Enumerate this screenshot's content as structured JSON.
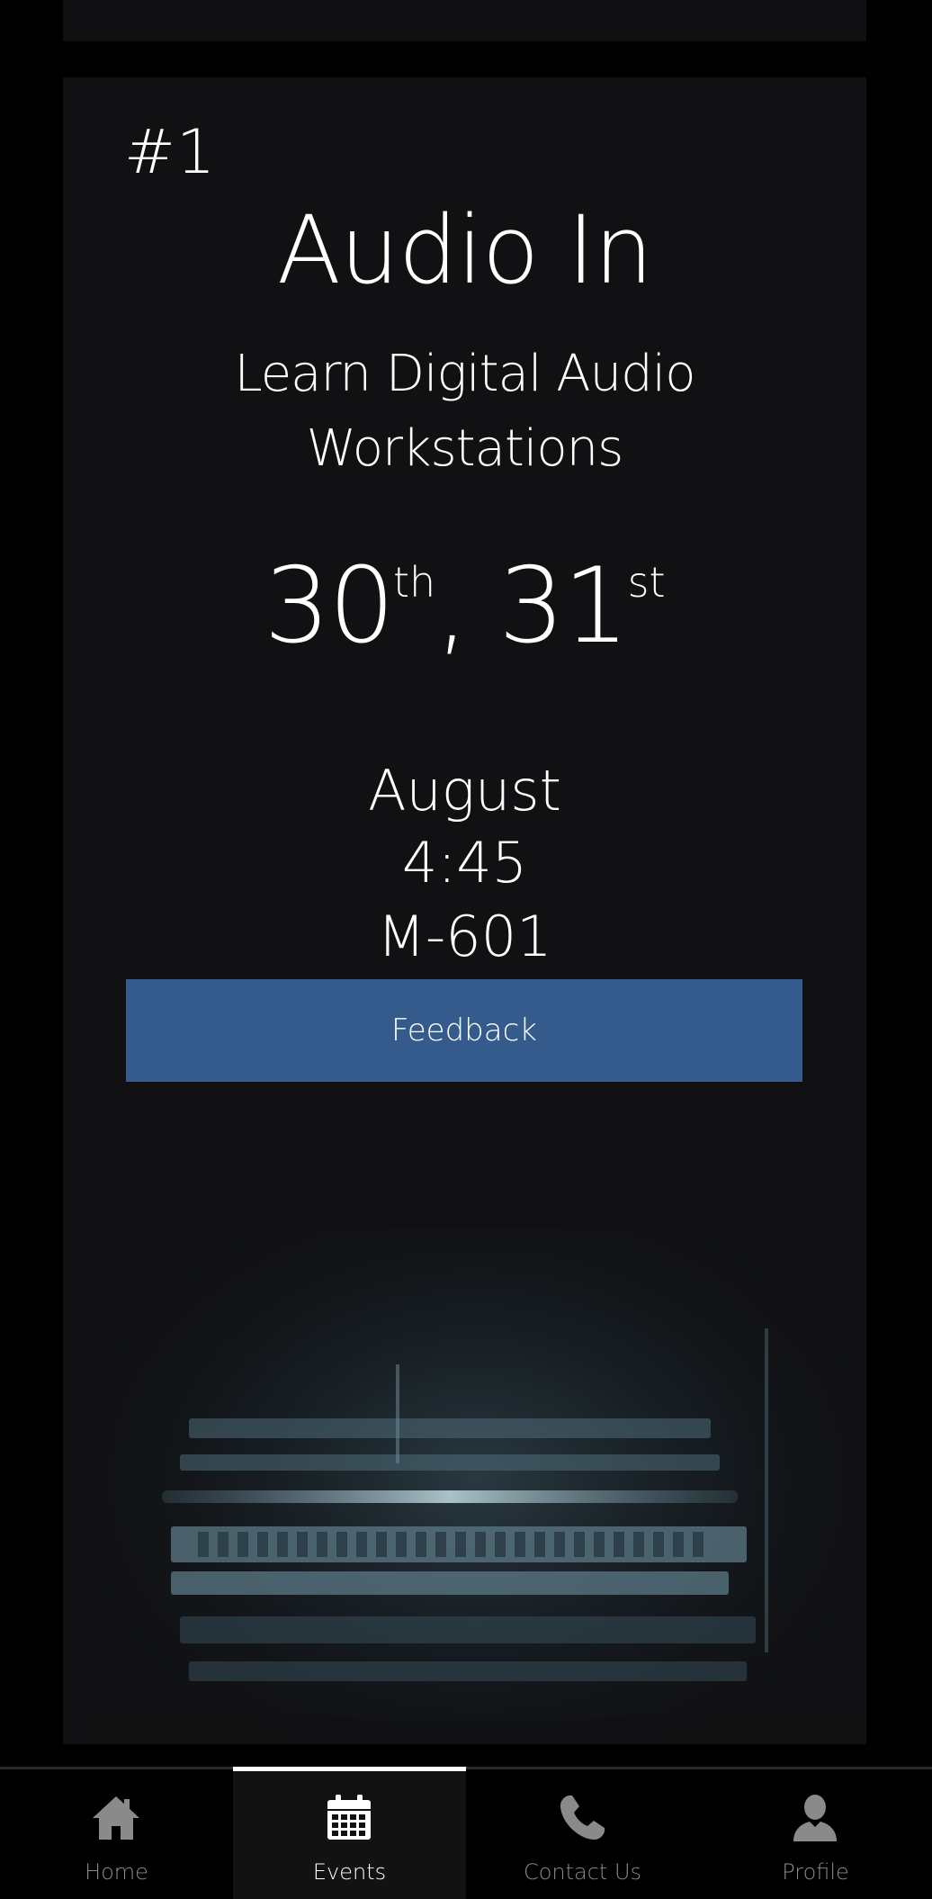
{
  "event": {
    "number": "#1",
    "title": "Audio In",
    "subtitle": "Learn Digital Audio Workstations",
    "date_first": "30",
    "date_first_suffix": "th",
    "date_separator": ", ",
    "date_second": "31",
    "date_second_suffix": "st",
    "month": "August",
    "time": "4:45",
    "venue": "M-601",
    "feedback_label": "Feedback"
  },
  "nav": {
    "tabs": [
      {
        "label": "Home",
        "icon": "home-icon",
        "active": false
      },
      {
        "label": "Events",
        "icon": "calendar-icon",
        "active": true
      },
      {
        "label": "Contact Us",
        "icon": "phone-icon",
        "active": false
      },
      {
        "label": "Profile",
        "icon": "user-icon",
        "active": false
      }
    ]
  },
  "colors": {
    "background": "#000000",
    "card": "#111113",
    "accent_button": "#355b8c",
    "inactive_nav": "#8a8a8a",
    "active_nav": "#ffffff"
  }
}
